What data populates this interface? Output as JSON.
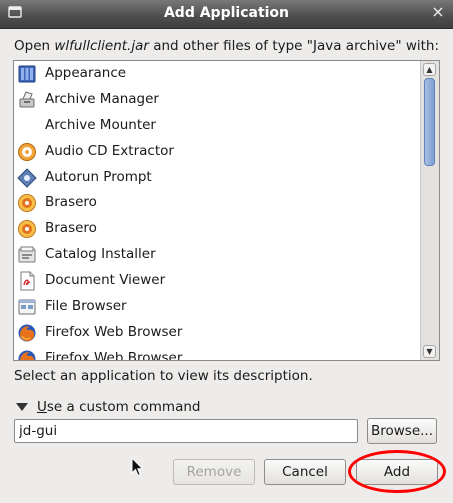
{
  "window": {
    "title": "Add Application",
    "close_glyph": "×"
  },
  "prompt": {
    "prefix": "Open ",
    "filename": "wlfullclient.jar",
    "suffix": " and other files of type \"Java archive\" with:"
  },
  "applications": [
    {
      "label": "Appearance",
      "icon": "appearance-icon"
    },
    {
      "label": "Archive Manager",
      "icon": "archive-manager-icon"
    },
    {
      "label": "Archive Mounter",
      "icon": "none"
    },
    {
      "label": "Audio CD Extractor",
      "icon": "audio-cd-icon"
    },
    {
      "label": "Autorun Prompt",
      "icon": "autorun-icon"
    },
    {
      "label": "Brasero",
      "icon": "brasero-icon"
    },
    {
      "label": "Brasero",
      "icon": "brasero-icon"
    },
    {
      "label": "Catalog Installer",
      "icon": "catalog-installer-icon"
    },
    {
      "label": "Document Viewer",
      "icon": "document-viewer-icon"
    },
    {
      "label": "File Browser",
      "icon": "file-browser-icon"
    },
    {
      "label": "Firefox Web Browser",
      "icon": "firefox-icon"
    },
    {
      "label": "Firefox Web Browser",
      "icon": "firefox-icon"
    }
  ],
  "description": "Select an application to view its description.",
  "custom_command": {
    "mnemonic": "U",
    "label_rest": "se a custom command",
    "value": "jd-gui"
  },
  "buttons": {
    "browse": "Browse...",
    "remove": "Remove",
    "cancel": "Cancel",
    "add": "Add"
  },
  "colors": {
    "annotation_circle": "#ff0000",
    "scroll_thumb": "#7d9fd2"
  }
}
